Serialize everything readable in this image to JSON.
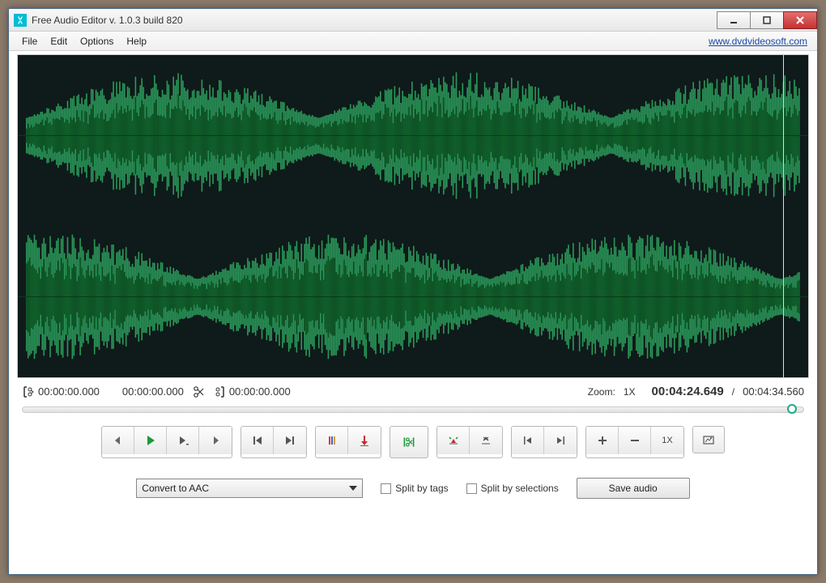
{
  "window": {
    "title": "Free Audio Editor v. 1.0.3 build 820"
  },
  "menubar": {
    "file": "File",
    "edit": "Edit",
    "options": "Options",
    "help": "Help",
    "link": "www.dvdvideosoft.com"
  },
  "timecodes": {
    "sel_start": "00:00:00.000",
    "sel_end": "00:00:00.000",
    "sel_dur": "00:00:00.000"
  },
  "zoom": {
    "label": "Zoom:",
    "value": "1X"
  },
  "position": {
    "current": "00:04:24.649",
    "sep": "/",
    "total": "00:04:34.560"
  },
  "controls": {
    "zoom_level": "1X"
  },
  "bottom": {
    "convert_selected": "Convert to AAC",
    "split_tags": "Split by tags",
    "split_selections": "Split by selections",
    "save": "Save audio"
  }
}
